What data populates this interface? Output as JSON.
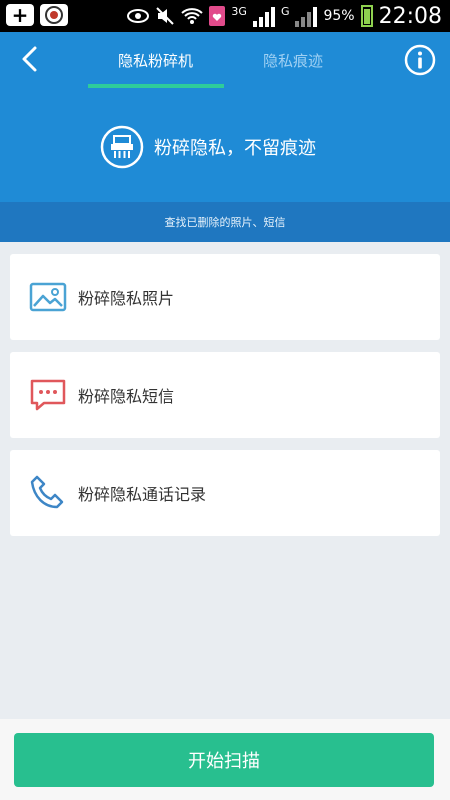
{
  "status_bar": {
    "network_3g": "3G",
    "network_g": "G",
    "battery": "95%",
    "time": "22:08"
  },
  "header": {
    "tabs": [
      {
        "label": "隐私粉碎机",
        "active": true
      },
      {
        "label": "隐私痕迹",
        "active": false
      }
    ],
    "hero_text": "粉碎隐私，不留痕迹",
    "subtitle": "查找已删除的照片、短信",
    "colors": {
      "primary": "#1f8bd6",
      "subbar": "#1f77c0",
      "accent": "#2ecc9a"
    }
  },
  "items": [
    {
      "label": "粉碎隐私照片",
      "icon": "photo-icon"
    },
    {
      "label": "粉碎隐私短信",
      "icon": "message-icon"
    },
    {
      "label": "粉碎隐私通话记录",
      "icon": "phone-icon"
    }
  ],
  "action": {
    "start_label": "开始扫描",
    "color": "#28bf8f"
  }
}
